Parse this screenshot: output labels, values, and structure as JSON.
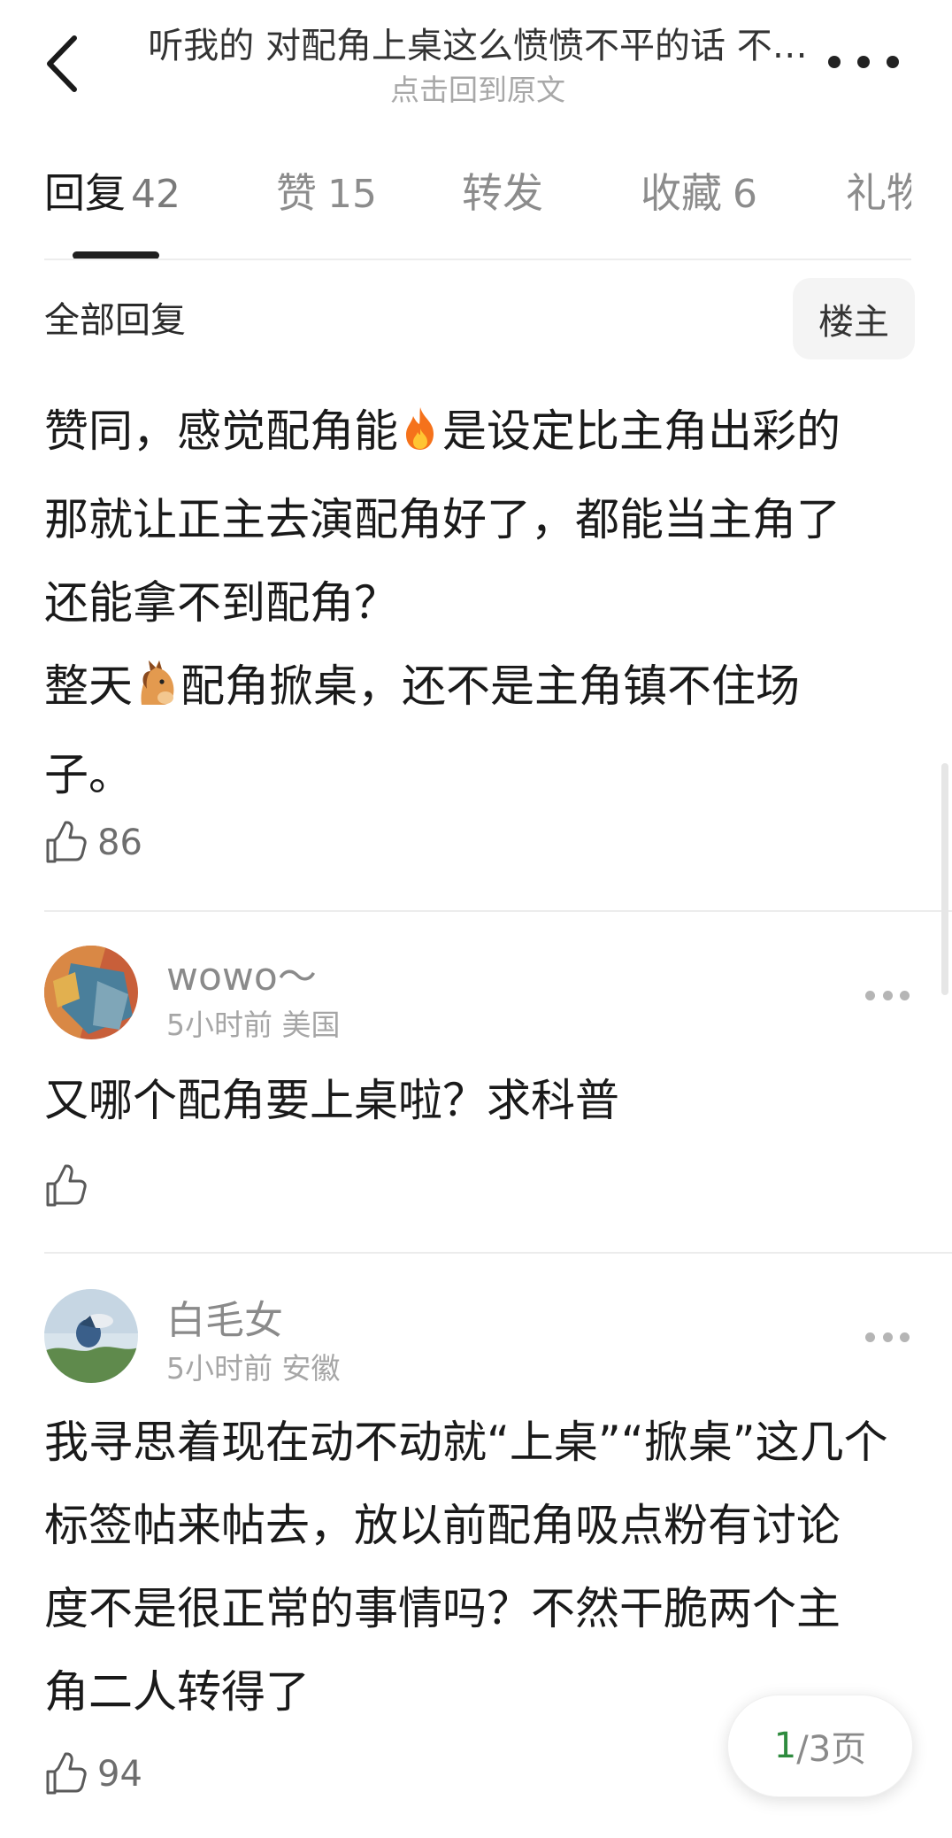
{
  "header": {
    "title": "听我的 对配角上桌这么愤愤不平的话 不…",
    "subtitle": "点击回到原文"
  },
  "tabs": [
    {
      "label": "回复",
      "count": "42"
    },
    {
      "label": "赞",
      "count": "15"
    },
    {
      "label": "转发",
      "count": ""
    },
    {
      "label": "收藏",
      "count": "6"
    },
    {
      "label": "礼物",
      "count": ""
    }
  ],
  "filter": {
    "label": "全部回复",
    "owner_button": "楼主"
  },
  "main_post": {
    "lines": [
      [
        "赞同，感觉配角能",
        "是设定比主角出彩的"
      ],
      [
        "那就让正主去演配角好了，都能当主角了"
      ],
      [
        "还能拿不到配角？"
      ],
      [
        "整天",
        "配角掀桌，还不是主角镇不住场"
      ],
      [
        "子。"
      ]
    ],
    "likes": "86"
  },
  "comments": [
    {
      "username": "wowo～",
      "meta": "5小时前 美国",
      "text": "又哪个配角要上桌啦？求科普",
      "likes": ""
    },
    {
      "username": "白毛女",
      "meta": "5小时前 安徽",
      "lines": [
        "我寻思着现在动不动就“上桌”“掀桌”这几个",
        "标签帖来帖去，放以前配角吸点粉有讨论",
        "度不是很正常的事情吗？不然干脆两个主",
        "角二人转得了"
      ],
      "likes": "94"
    }
  ],
  "pager": {
    "current": "1",
    "total": "/3页"
  },
  "icons": {
    "fire": "fire-emoji",
    "horse": "horse-face-emoji",
    "like": "thumbs-up-icon"
  }
}
